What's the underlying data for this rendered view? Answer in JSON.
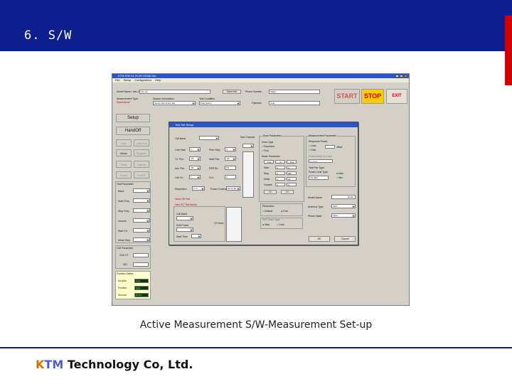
{
  "slide": {
    "title": "6. S/W",
    "caption": "Active Measurement S/W-Measurement Set-up",
    "footer_k": "K",
    "footer_tm": "TM",
    "footer_rest": " Technology Co, Ltd.",
    "colors": {
      "header": "#0d1f8f",
      "accent_red": "#d00000"
    }
  },
  "app": {
    "title": "KTM  S/W for  IS-95  CDMA Set",
    "menu": [
      "File",
      "Setup",
      "Configuration",
      "Help"
    ],
    "fields": {
      "model_name_label": "Model Name / Info Ver",
      "model_name_value": "Info Ver",
      "save_info": "Save Info",
      "phone_number_label": "Phone Number",
      "phone_number_value": "Maker",
      "measurement_type_label": "Measurement Type",
      "measurement_type_value": "Stand Alone",
      "search_information_label": "Search Information",
      "search_information_value": "Sector with Active Set",
      "test_condition_label": "Test Condition",
      "test_condition_value": "Free Space",
      "operator_label": "Operator",
      "operator_value": "Cola"
    },
    "buttons": {
      "start": "START",
      "stop": "STOP",
      "exit": "EXIT"
    },
    "left_panel": {
      "setup": "Setup",
      "handoff": "HandOff",
      "row1": [
        "Call",
        "Call End"
      ],
      "row2": [
        "Meas",
        "Register"
      ],
      "row3": [
        "Print",
        "Capture"
      ],
      "row4": [
        "Excel",
        "Fr.B.E."
      ],
      "test_parameter": "Test Parameter",
      "params": [
        "Band",
        "Start Freq",
        "Stop Freq",
        "Volume",
        "Start Ch",
        "Meas Step"
      ],
      "call_parameter": "Call Parameter",
      "call_params": [
        "CH# CT",
        "SID"
      ],
      "position_status": "Position Status",
      "positions": [
        {
          "label": "Az Axis",
          "value": "0 dA"
        },
        {
          "label": "Position",
          "value": "Stop"
        },
        {
          "label": "Second",
          "value": "90 Pct"
        }
      ]
    }
  },
  "dialog": {
    "title": "Test Set Setup",
    "left": {
      "cell_band": "Cell Band",
      "grid": [
        [
          "Link Rate",
          "1",
          "Peer Step",
          "3"
        ],
        [
          "Tx. Pwr.",
          "-15",
          "Start Pwr.",
          "-20"
        ],
        [
          "Ant. Pwr.",
          "-50",
          "FER Rx.",
          "0.5"
        ],
        [
          "Cell Ch.",
          "1",
          "S.N.",
          "0"
        ]
      ],
      "columns": "Sub Channel",
      "resolution": "Resolution",
      "resolution_value": "1 ch",
      "power_control": "Power Control",
      "power_control_value": "All Up bit",
      "handoff_test": "Hand Off Test",
      "new_rc_test": "New RC Test Below",
      "call_band": "Call Band",
      "drift_power": "Drift Power",
      "start_time": "Start Time",
      "ch_number": "CH Num."
    },
    "scan": {
      "title": "Scan Parameter",
      "scan_type": "Scan Type",
      "opt1": "Rad Area",
      "opt2": "Pow",
      "mode": "Mode Parameter",
      "headers": [
        "Axis",
        "Ax",
        "Pos"
      ],
      "rows": [
        {
          "label": "Start",
          "v1": "0",
          "v2": "0"
        },
        {
          "label": "Stop",
          "v1": "0",
          "v2": "360"
        },
        {
          "label": "Delta",
          "v1": "0",
          "v2": "10"
        },
        {
          "label": "Grades",
          "v1": "0",
          "v2": "0"
        }
      ],
      "ok1": "OK",
      "ok2": "OK",
      "resolution": "Resolution",
      "res_opt1": "Default",
      "res_opt2": "Fine",
      "dtype": "DUT Scan Type",
      "dtype_opt1": "Step",
      "dtype_opt2": "Cont"
    },
    "meas": {
      "title": "Measurement Parameter",
      "response_power": "Response Power",
      "rp_opt1": "Loss",
      "rp_opt2": "Gain",
      "offset": "offset",
      "fs_label": "Power Meas To Loss",
      "fs_value": "Fs Rate",
      "test_pw": "Test Pwr Type",
      "tp_value": "Power Limit Type",
      "tp_value2": "0.0 dBm",
      "tp_opt1": "Max",
      "tp_opt2": "Min",
      "model_name": "Model Name",
      "model_value": "Model",
      "antenna_type": "Antenna Type",
      "antenna_value": "UDS",
      "phone_state": "Phone State",
      "phone_state_value": "Open",
      "ok": "OK",
      "cancel": "Cancel"
    }
  }
}
